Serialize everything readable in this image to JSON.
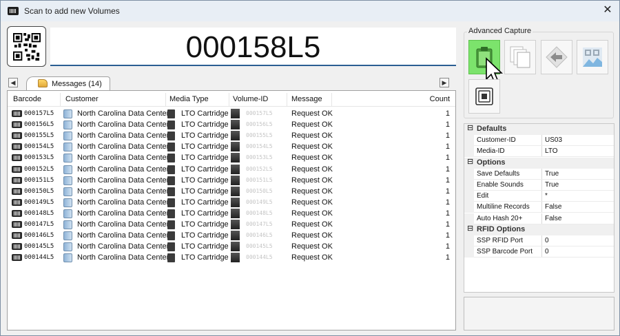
{
  "window": {
    "title": "Scan to add new Volumes",
    "close_glyph": "✕"
  },
  "barcode_input": {
    "value": "000158L5"
  },
  "tabs": [
    {
      "label": "Messages (14)"
    }
  ],
  "list": {
    "columns": [
      "Barcode",
      "Customer",
      "Media Type",
      "Volume-ID",
      "Message",
      "Count"
    ],
    "rows": [
      {
        "barcode": "000157L5",
        "customer": "North Carolina Data Center",
        "media_type": "LTO Cartridge",
        "volume_id": "000157L5",
        "message": "Request OK",
        "count": "1"
      },
      {
        "barcode": "000156L5",
        "customer": "North Carolina Data Center",
        "media_type": "LTO Cartridge",
        "volume_id": "000156L5",
        "message": "Request OK",
        "count": "1"
      },
      {
        "barcode": "000155L5",
        "customer": "North Carolina Data Center",
        "media_type": "LTO Cartridge",
        "volume_id": "000155L5",
        "message": "Request OK",
        "count": "1"
      },
      {
        "barcode": "000154L5",
        "customer": "North Carolina Data Center",
        "media_type": "LTO Cartridge",
        "volume_id": "000154L5",
        "message": "Request OK",
        "count": "1"
      },
      {
        "barcode": "000153L5",
        "customer": "North Carolina Data Center",
        "media_type": "LTO Cartridge",
        "volume_id": "000153L5",
        "message": "Request OK",
        "count": "1"
      },
      {
        "barcode": "000152L5",
        "customer": "North Carolina Data Center",
        "media_type": "LTO Cartridge",
        "volume_id": "000152L5",
        "message": "Request OK",
        "count": "1"
      },
      {
        "barcode": "000151L5",
        "customer": "North Carolina Data Center",
        "media_type": "LTO Cartridge",
        "volume_id": "000151L5",
        "message": "Request OK",
        "count": "1"
      },
      {
        "barcode": "000150L5",
        "customer": "North Carolina Data Center",
        "media_type": "LTO Cartridge",
        "volume_id": "000150L5",
        "message": "Request OK",
        "count": "1"
      },
      {
        "barcode": "000149L5",
        "customer": "North Carolina Data Center",
        "media_type": "LTO Cartridge",
        "volume_id": "000149L5",
        "message": "Request OK",
        "count": "1"
      },
      {
        "barcode": "000148L5",
        "customer": "North Carolina Data Center",
        "media_type": "LTO Cartridge",
        "volume_id": "000148L5",
        "message": "Request OK",
        "count": "1"
      },
      {
        "barcode": "000147L5",
        "customer": "North Carolina Data Center",
        "media_type": "LTO Cartridge",
        "volume_id": "000147L5",
        "message": "Request OK",
        "count": "1"
      },
      {
        "barcode": "000146L5",
        "customer": "North Carolina Data Center",
        "media_type": "LTO Cartridge",
        "volume_id": "000146L5",
        "message": "Request OK",
        "count": "1"
      },
      {
        "barcode": "000145L5",
        "customer": "North Carolina Data Center",
        "media_type": "LTO Cartridge",
        "volume_id": "000145L5",
        "message": "Request OK",
        "count": "1"
      },
      {
        "barcode": "000144L5",
        "customer": "North Carolina Data Center",
        "media_type": "LTO Cartridge",
        "volume_id": "000144L5",
        "message": "Request OK",
        "count": "1"
      }
    ]
  },
  "advanced_capture": {
    "label": "Advanced Capture",
    "buttons": [
      {
        "icon": "clipboard-icon",
        "active": true
      },
      {
        "icon": "copy-pages-icon",
        "active": false
      },
      {
        "icon": "import-arrow-icon",
        "active": false
      },
      {
        "icon": "barcode-image-icon",
        "active": false
      },
      {
        "icon": "rfid-chip-icon",
        "active": false
      }
    ]
  },
  "properties": [
    {
      "type": "category",
      "name": "Defaults",
      "toggle": "⊟"
    },
    {
      "type": "prop",
      "name": "Customer-ID",
      "value": "US03"
    },
    {
      "type": "prop",
      "name": "Media-ID",
      "value": "LTO"
    },
    {
      "type": "category",
      "name": "Options",
      "toggle": "⊟"
    },
    {
      "type": "prop",
      "name": "Save Defaults",
      "value": "True"
    },
    {
      "type": "prop",
      "name": "Enable Sounds",
      "value": "True"
    },
    {
      "type": "prop",
      "name": "Edit",
      "value": "*"
    },
    {
      "type": "prop",
      "name": "Multiline Records",
      "value": "False"
    },
    {
      "type": "prop",
      "name": "Auto Hash 20+",
      "value": "False"
    },
    {
      "type": "category",
      "name": "RFID Options",
      "toggle": "⊟"
    },
    {
      "type": "prop",
      "name": "SSP RFID Port",
      "value": "0"
    },
    {
      "type": "prop",
      "name": "SSP Barcode Port",
      "value": "0"
    }
  ],
  "colors": {
    "active_capture": "#7ce36c",
    "input_underline": "#2a5e92"
  }
}
